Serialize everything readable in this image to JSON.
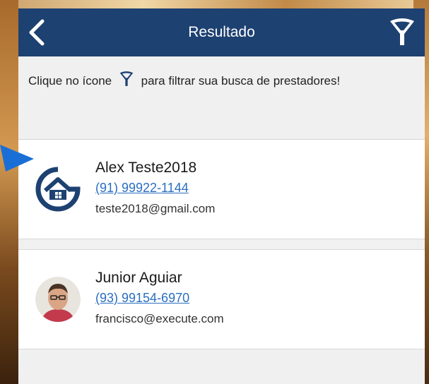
{
  "header": {
    "title": "Resultado",
    "back_icon": "chevron-left-icon",
    "filter_icon": "funnel-icon"
  },
  "hint": {
    "text_before": "Clique no ícone",
    "text_after": "para filtrar sua busca de prestadores!"
  },
  "results": [
    {
      "name": "Alex Teste2018",
      "phone": "(91) 99922-1144",
      "email": "teste2018@gmail.com",
      "avatar": "house-logo-icon"
    },
    {
      "name": "Junior Aguiar",
      "phone": "(93) 99154-6970",
      "email": "francisco@execute.com",
      "avatar": "person-photo"
    }
  ],
  "colors": {
    "navbar": "#1d4171",
    "link": "#2a6ec0",
    "pointer": "#1a6fd6"
  }
}
